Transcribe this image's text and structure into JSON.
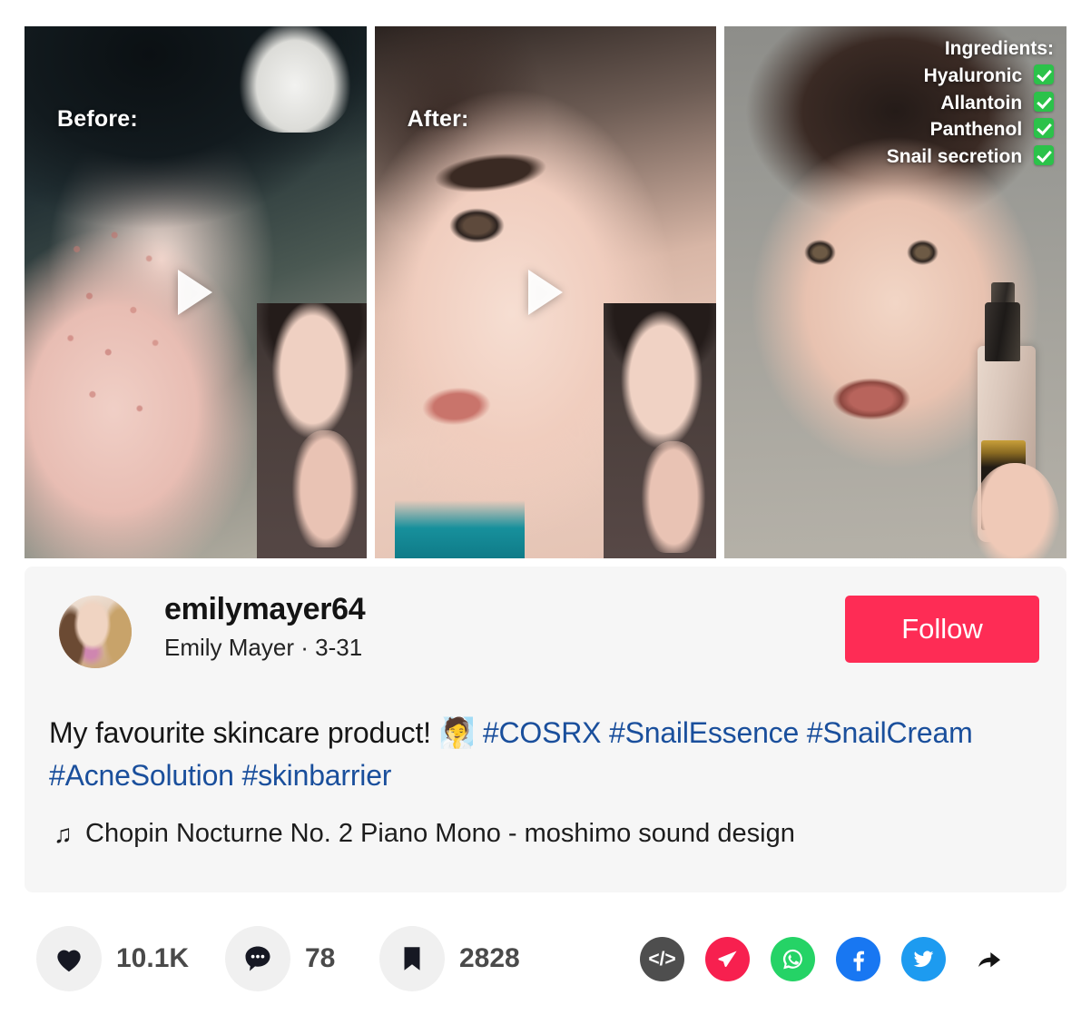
{
  "panels": [
    {
      "overlay_label": "Before:",
      "has_play": true,
      "media": "before-closeup-acne-face"
    },
    {
      "overlay_label": "After:",
      "has_play": true,
      "media": "after-clear-skin-face"
    },
    {
      "overlay_label": "",
      "has_play": false,
      "media": "creator-holding-product-bottle"
    }
  ],
  "ingredients": {
    "title": "Ingredients:",
    "items": [
      "Hyaluronic",
      "Allantoin",
      "Panthenol",
      "Snail secretion"
    ],
    "check_color": "#2bc24a"
  },
  "post": {
    "username": "emilymayer64",
    "display_name": "Emily Mayer",
    "separator": "·",
    "date": "3-31",
    "follow_label": "Follow",
    "follow_color": "#fe2c55",
    "caption_plain": "My favourite skincare product! 🧖",
    "caption_parts": [
      {
        "type": "text",
        "value": "My favourite skincare product! 🧖 "
      },
      {
        "type": "tag",
        "value": "#COSRX"
      },
      {
        "type": "text",
        "value": " "
      },
      {
        "type": "tag",
        "value": "#SnailEssence"
      },
      {
        "type": "text",
        "value": " "
      },
      {
        "type": "tag",
        "value": "#SnailCream"
      },
      {
        "type": "text",
        "value": " "
      },
      {
        "type": "tag",
        "value": "#AcneSolution"
      },
      {
        "type": "text",
        "value": " "
      },
      {
        "type": "tag",
        "value": "#skinbarrier"
      }
    ],
    "hashtags": [
      "#COSRX",
      "#SnailEssence",
      "#SnailCream",
      "#AcneSolution",
      "#skinbarrier"
    ],
    "hashtag_color": "#1a4f9c",
    "music_note": "♫",
    "music_title": "Chopin Nocturne No. 2 Piano Mono - moshimo sound design"
  },
  "stats": [
    {
      "icon": "heart-icon",
      "value": "10.1K"
    },
    {
      "icon": "comment-icon",
      "value": "78"
    },
    {
      "icon": "bookmark-icon",
      "value": "2828"
    }
  ],
  "share": [
    {
      "icon": "embed-code-icon",
      "label": "</>",
      "color": "#4e4e4e"
    },
    {
      "icon": "send-icon",
      "label": "",
      "color": "#f7204f"
    },
    {
      "icon": "whatsapp-icon",
      "label": "",
      "color": "#25d366"
    },
    {
      "icon": "facebook-icon",
      "label": "",
      "color": "#1877f2"
    },
    {
      "icon": "twitter-icon",
      "label": "",
      "color": "#1d9bf0"
    },
    {
      "icon": "share-arrow-icon",
      "label": "",
      "color": "#111111"
    }
  ]
}
